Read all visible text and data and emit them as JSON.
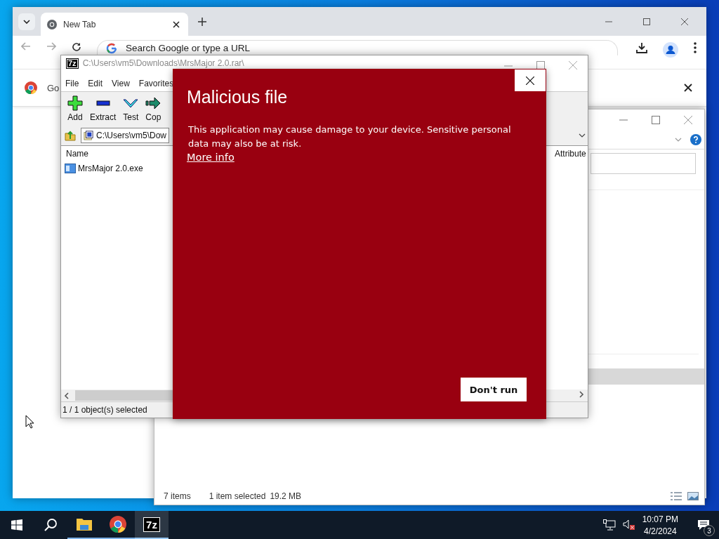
{
  "browser": {
    "tabs": [
      {
        "title": "New Tab",
        "selected": true
      }
    ],
    "omnibox": {
      "placeholder": "Search Google or type a URL"
    },
    "infobar": {
      "text": "Go"
    }
  },
  "archive_window": {
    "logo": "7z",
    "title": "C:\\Users\\vm5\\Downloads\\MrsMajor 2.0.rar\\",
    "menu": [
      "File",
      "Edit",
      "View",
      "Favorites"
    ],
    "toolbar": [
      {
        "kind": "add",
        "label": "Add"
      },
      {
        "kind": "extract",
        "label": "Extract"
      },
      {
        "kind": "test",
        "label": "Test"
      },
      {
        "kind": "copy",
        "label": "Cop"
      }
    ],
    "address": "C:\\Users\\vm5\\Dow",
    "columns": [
      "Name",
      "Attribute"
    ],
    "rows": [
      {
        "name": "MrsMajor 2.0.exe"
      }
    ],
    "status": "1 / 1 object(s) selected"
  },
  "explorer": {
    "status": [
      "7 items",
      "1 item selected",
      "19.2 MB"
    ]
  },
  "dialog": {
    "title": "Malicious file",
    "message": "This application may cause damage to your device. Sensitive personal data may also be at risk.",
    "link": "More info",
    "button": "Don't run"
  },
  "taskbar": {
    "apps": [
      {
        "kind": "explorer",
        "selected": false
      },
      {
        "kind": "chrome",
        "selected": false
      },
      {
        "kind": "sevenzip",
        "label": "7z",
        "selected": true
      }
    ],
    "time": "10:07 PM",
    "date": "4/2/2024",
    "notifications": "3"
  }
}
